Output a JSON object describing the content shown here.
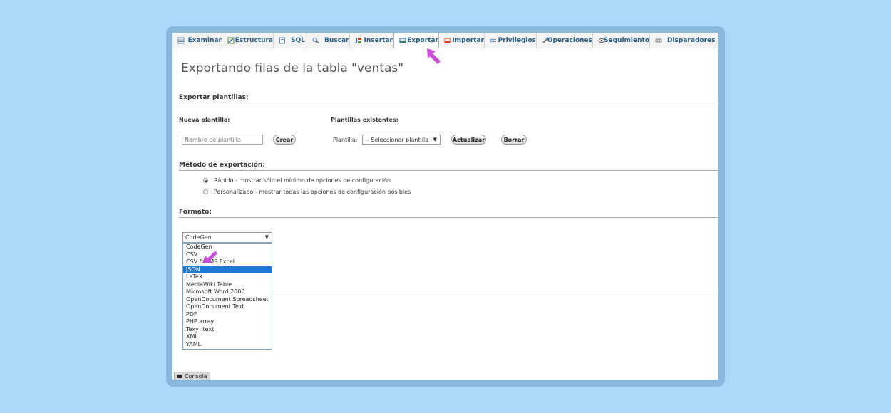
{
  "tabs": [
    {
      "label": "Examinar",
      "icon": "browse-icon",
      "active": false
    },
    {
      "label": "Estructura",
      "icon": "structure-icon",
      "active": false
    },
    {
      "label": "SQL",
      "icon": "sql-icon",
      "active": false
    },
    {
      "label": "Buscar",
      "icon": "search-icon",
      "active": false
    },
    {
      "label": "Insertar",
      "icon": "insert-icon",
      "active": false
    },
    {
      "label": "Exportar",
      "icon": "export-icon",
      "active": true
    },
    {
      "label": "Importar",
      "icon": "import-icon",
      "active": false
    },
    {
      "label": "Privilegios",
      "icon": "privileges-icon",
      "active": false
    },
    {
      "label": "Operaciones",
      "icon": "wrench-icon",
      "active": false
    },
    {
      "label": "Seguimiento",
      "icon": "eye-icon",
      "active": false
    },
    {
      "label": "Disparadores",
      "icon": "trigger-icon",
      "active": false
    }
  ],
  "page": {
    "title": "Exportando filas de la tabla \"ventas\""
  },
  "templates": {
    "heading": "Exportar plantillas:",
    "new_label": "Nueva plantilla:",
    "existing_label": "Plantillas existentes:",
    "name_placeholder": "Nombre de plantilla",
    "create_button": "Crear",
    "template_label": "Plantilla:",
    "select_value": "-- Seleccionar plantilla --",
    "update_button": "Actualizar",
    "delete_button": "Borrar"
  },
  "method": {
    "heading": "Método de exportación:",
    "options": [
      {
        "label": "Rápido - mostrar sólo el mínimo de opciones de configuración",
        "checked": true
      },
      {
        "label": "Personalizado - mostrar todas las opciones de configuración posibles",
        "checked": false
      }
    ]
  },
  "format": {
    "heading": "Formato:",
    "selected": "CodeGen",
    "highlighted": "JSON",
    "options": [
      "CodeGen",
      "CSV",
      "CSV for MS Excel",
      "JSON",
      "LaTeX",
      "MediaWiki Table",
      "Microsoft Word 2000",
      "OpenDocument Spreadsheet",
      "OpenDocument Text",
      "PDF",
      "PHP array",
      "Texy! text",
      "XML",
      "YAML"
    ]
  },
  "console": {
    "label": "Consola"
  },
  "colors": {
    "background": "#aad8fb",
    "frame": "#89b8dd",
    "tab_text": "#235a81",
    "highlight": "#1e78d6",
    "pointer": "#c94fd6"
  }
}
